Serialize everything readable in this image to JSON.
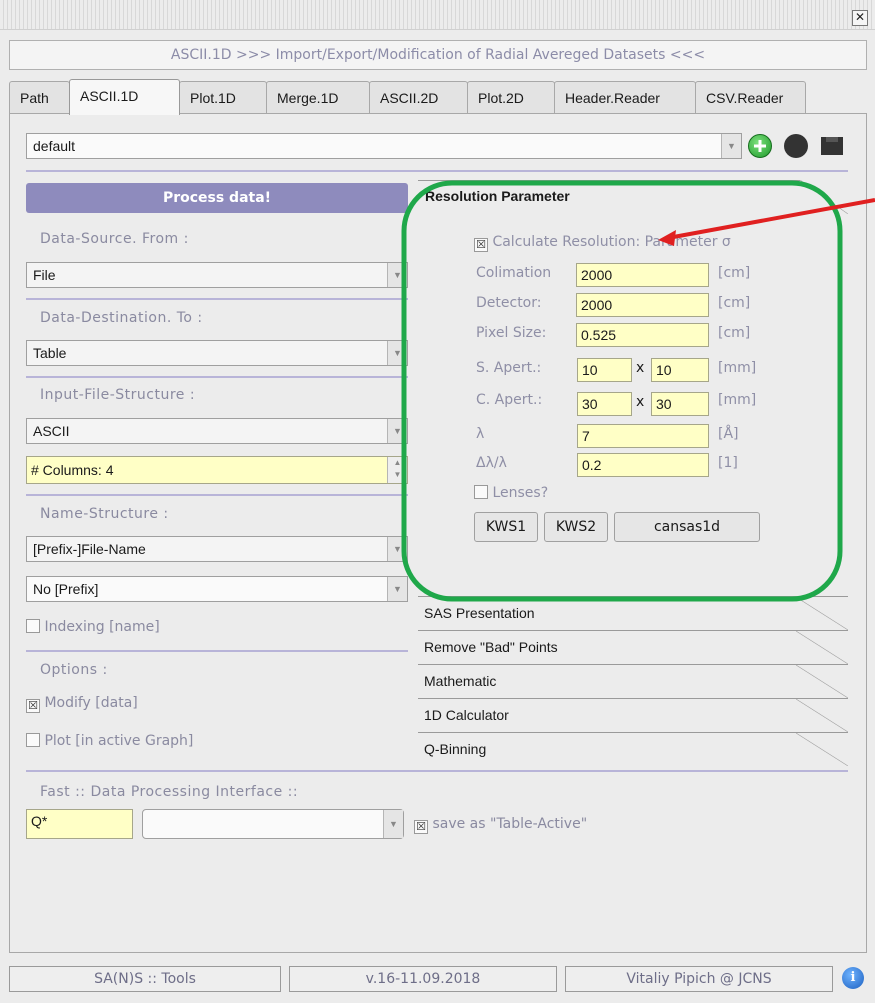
{
  "window": {
    "close_glyph": "✕"
  },
  "header": {
    "title": "ASCII.1D  >>> Import/Export/Modification of Radial Avereged Datasets <<<"
  },
  "tabs": [
    {
      "label": "Path"
    },
    {
      "label": "ASCII.1D"
    },
    {
      "label": "Plot.1D"
    },
    {
      "label": "Merge.1D"
    },
    {
      "label": "ASCII.2D"
    },
    {
      "label": "Plot.2D"
    },
    {
      "label": "Header.Reader"
    },
    {
      "label": "CSV.Reader"
    }
  ],
  "preset": {
    "value": "default"
  },
  "left": {
    "process_label": "Process data!",
    "data_source_label": "Data-Source. From :",
    "data_source_value": "File",
    "data_dest_label": "Data-Destination. To :",
    "data_dest_value": "Table",
    "input_structure_label": "Input-File-Structure :",
    "input_structure_value": "ASCII",
    "columns_value": "# Columns:  4",
    "name_structure_label": "Name-Structure :",
    "name_structure_value": "[Prefix-]File-Name",
    "prefix_value": "No [Prefix]",
    "indexing_label": "Indexing [name]",
    "options_label": "Options :",
    "modify_label": "Modify [data]",
    "plot_label": "Plot [in active Graph]"
  },
  "resolution": {
    "title": "Resolution Parameter",
    "calc_label": "Calculate Resolution: Parameter σ",
    "colimation_label": "Colimation",
    "colimation_value": "2000",
    "colimation_unit": "[cm]",
    "detector_label": "Detector:",
    "detector_value": "2000",
    "detector_unit": "[cm]",
    "pixel_label": "Pixel Size:",
    "pixel_value": "0.525",
    "pixel_unit": "[cm]",
    "s_apert_label": "S. Apert.:",
    "s_apert_x": "10",
    "s_apert_y": "10",
    "s_apert_unit": "[mm]",
    "c_apert_label": "C. Apert.:",
    "c_apert_x": "30",
    "c_apert_y": "30",
    "c_apert_unit": "[mm]",
    "times": "x",
    "lambda_label": "λ",
    "lambda_value": "7",
    "lambda_unit": "[Å]",
    "dlambda_label": "Δλ/λ",
    "dlambda_value": "0.2",
    "dlambda_unit": "[1]",
    "lenses_label": "Lenses?",
    "kws1": "KWS1",
    "kws2": "KWS2",
    "cansas": "cansas1d"
  },
  "stack_tabs": [
    {
      "label": "SAS Presentation"
    },
    {
      "label": "Remove \"Bad\" Points"
    },
    {
      "label": "Mathematic"
    },
    {
      "label": "1D Calculator"
    },
    {
      "label": "Q-Binning"
    }
  ],
  "fast": {
    "label": "Fast :: Data Processing Interface ::",
    "q_value": "Q*",
    "save_label": "save as \"Table-Active\""
  },
  "status": {
    "left": "SA(N)S :: Tools",
    "middle": "v.16-11.09.2018",
    "right": "Vitaliy Pipich @ JCNS"
  },
  "colors": {
    "accent": "#8e8bbd",
    "annotation_box": "#1fa84a",
    "annotation_arrow": "#e02020",
    "input_bg": "#ffffc6"
  }
}
